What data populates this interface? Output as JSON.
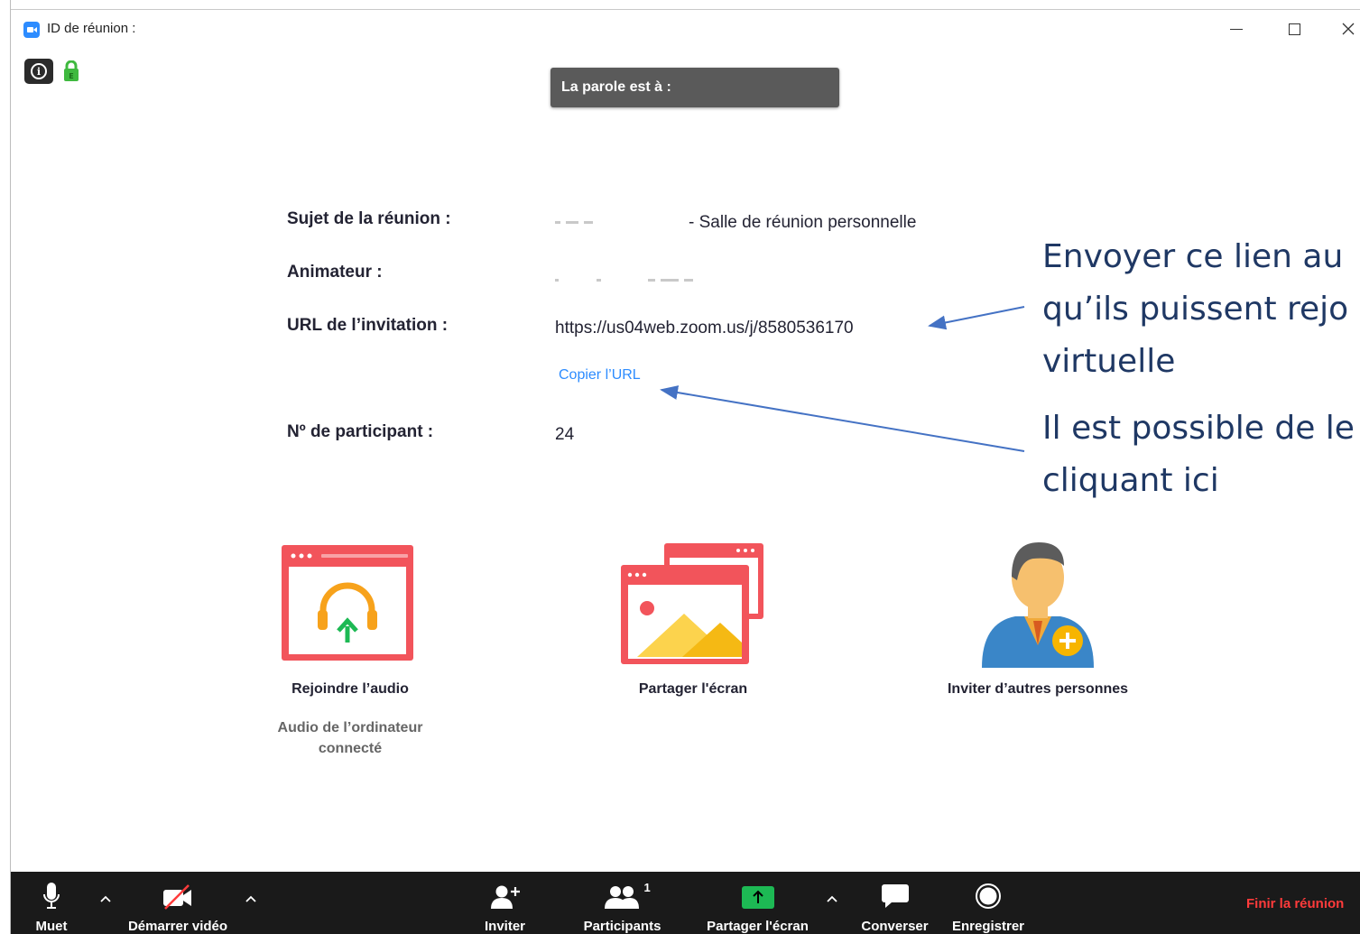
{
  "window": {
    "title": "ID de réunion : ",
    "controls": {
      "minimize": "minimize",
      "maximize": "maximize",
      "close": "close"
    }
  },
  "speaker_banner": "La parole est à :",
  "meeting_info": {
    "subject_label": "Sujet de la réunion :",
    "subject_value": "- Salle de réunion personnelle",
    "host_label": "Animateur :",
    "url_label": "URL de l’invitation :",
    "url_value": "https://us04web.zoom.us/j/8580536170",
    "copy_url": "Copier l’URL",
    "participant_label": "Nº de participant :",
    "participant_value": "24"
  },
  "annotations": {
    "line1": "Envoyer ce lien au",
    "line2": "qu’ils puissent rejo",
    "line3": "virtuelle",
    "line4": "Il est possible de le",
    "line5": "cliquant ici",
    "color": "#1f3864",
    "arrow_color": "#4472c4"
  },
  "actions": {
    "join_audio": "Rejoindre l’audio",
    "join_audio_sub1": "Audio de l’ordinateur",
    "join_audio_sub2": "connecté",
    "share_screen": "Partager l'écran",
    "invite_others": "Inviter d’autres personnes"
  },
  "toolbar": {
    "mute": "Muet",
    "start_video": "Démarrer vidéo",
    "invite": "Inviter",
    "participants": "Participants",
    "participants_count": "1",
    "share_screen": "Partager l'écran",
    "chat": "Converser",
    "record": "Enregistrer",
    "end_meeting": "Finir la réunion"
  },
  "colors": {
    "accent_blue": "#2d8cff",
    "share_green": "#1db954",
    "icon_red": "#f2545b",
    "end_red": "#ff3b3b",
    "toolbar_bg": "#1a1a1a"
  }
}
